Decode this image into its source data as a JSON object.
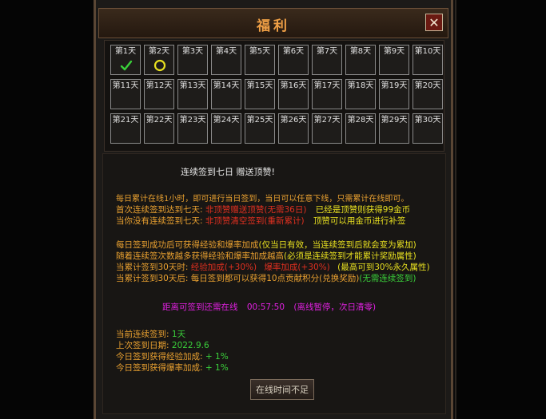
{
  "dialog": {
    "title": "福利",
    "close_label": "✕"
  },
  "days": [
    {
      "label": "第1天",
      "status": "signed"
    },
    {
      "label": "第2天",
      "status": "today"
    },
    {
      "label": "第3天",
      "status": ""
    },
    {
      "label": "第4天",
      "status": ""
    },
    {
      "label": "第5天",
      "status": ""
    },
    {
      "label": "第6天",
      "status": ""
    },
    {
      "label": "第7天",
      "status": ""
    },
    {
      "label": "第8天",
      "status": ""
    },
    {
      "label": "第9天",
      "status": ""
    },
    {
      "label": "第10天",
      "status": ""
    },
    {
      "label": "第11天",
      "status": ""
    },
    {
      "label": "第12天",
      "status": ""
    },
    {
      "label": "第13天",
      "status": ""
    },
    {
      "label": "第14天",
      "status": ""
    },
    {
      "label": "第15天",
      "status": ""
    },
    {
      "label": "第16天",
      "status": ""
    },
    {
      "label": "第17天",
      "status": ""
    },
    {
      "label": "第18天",
      "status": ""
    },
    {
      "label": "第19天",
      "status": ""
    },
    {
      "label": "第20天",
      "status": ""
    },
    {
      "label": "第21天",
      "status": ""
    },
    {
      "label": "第22天",
      "status": ""
    },
    {
      "label": "第23天",
      "status": ""
    },
    {
      "label": "第24天",
      "status": ""
    },
    {
      "label": "第25天",
      "status": ""
    },
    {
      "label": "第26天",
      "status": ""
    },
    {
      "label": "第27天",
      "status": ""
    },
    {
      "label": "第28天",
      "status": ""
    },
    {
      "label": "第29天",
      "status": ""
    },
    {
      "label": "第30天",
      "status": ""
    }
  ],
  "info": {
    "headline": "连续签到七日 赠送顶赞!",
    "rule1": "每日累计在线1小时，即可进行当日签到，当日可以任意下线，只需累计在线即可。",
    "rule2_a": "首次连续签到达到七天:",
    "rule2_b": "非顶赞赠送顶赞(无需36日)",
    "rule2_c": "已经是顶赞则获得99金币",
    "rule3_a": "当你没有连续签到七天:",
    "rule3_b": "非顶赞清空签到(重新累计)",
    "rule3_c": "顶赞可以用金币进行补签",
    "rule4_a": "每日签到成功后可获得经验和爆率加成",
    "rule4_b": "(仅当日有效，当连续签到后就会变为累加)",
    "rule5_a": "随着连续签次数越多获得经验和爆率加成越高",
    "rule5_b": "(必须是连续签到才能累计奖励属性)",
    "rule6_a": "当累计签到30天时:",
    "rule6_b": "经验加成(+30%)",
    "rule6_c": "爆率加成(+30%)",
    "rule6_d": "(最高可到30%永久属性)",
    "rule7_a": "当累计签到30天后: 每日签到都可以获得10点贡献积分(兑换奖励)",
    "rule7_b": "(无需连续签到)",
    "countdown_label": "距离可签到还需在线",
    "countdown_time": "00:57:50",
    "countdown_note": "(离线暂停，次日清零)",
    "streak_label": "当前连续签到:",
    "streak_value": "1天",
    "last_label": "上次签到日期:",
    "last_value": "2022.9.6",
    "exp_label": "今日签到获得经验加成:",
    "exp_value": "+ 1%",
    "drop_label": "今日签到获得爆率加成:",
    "drop_value": "+ 1%",
    "button_label": "在线时间不足"
  }
}
